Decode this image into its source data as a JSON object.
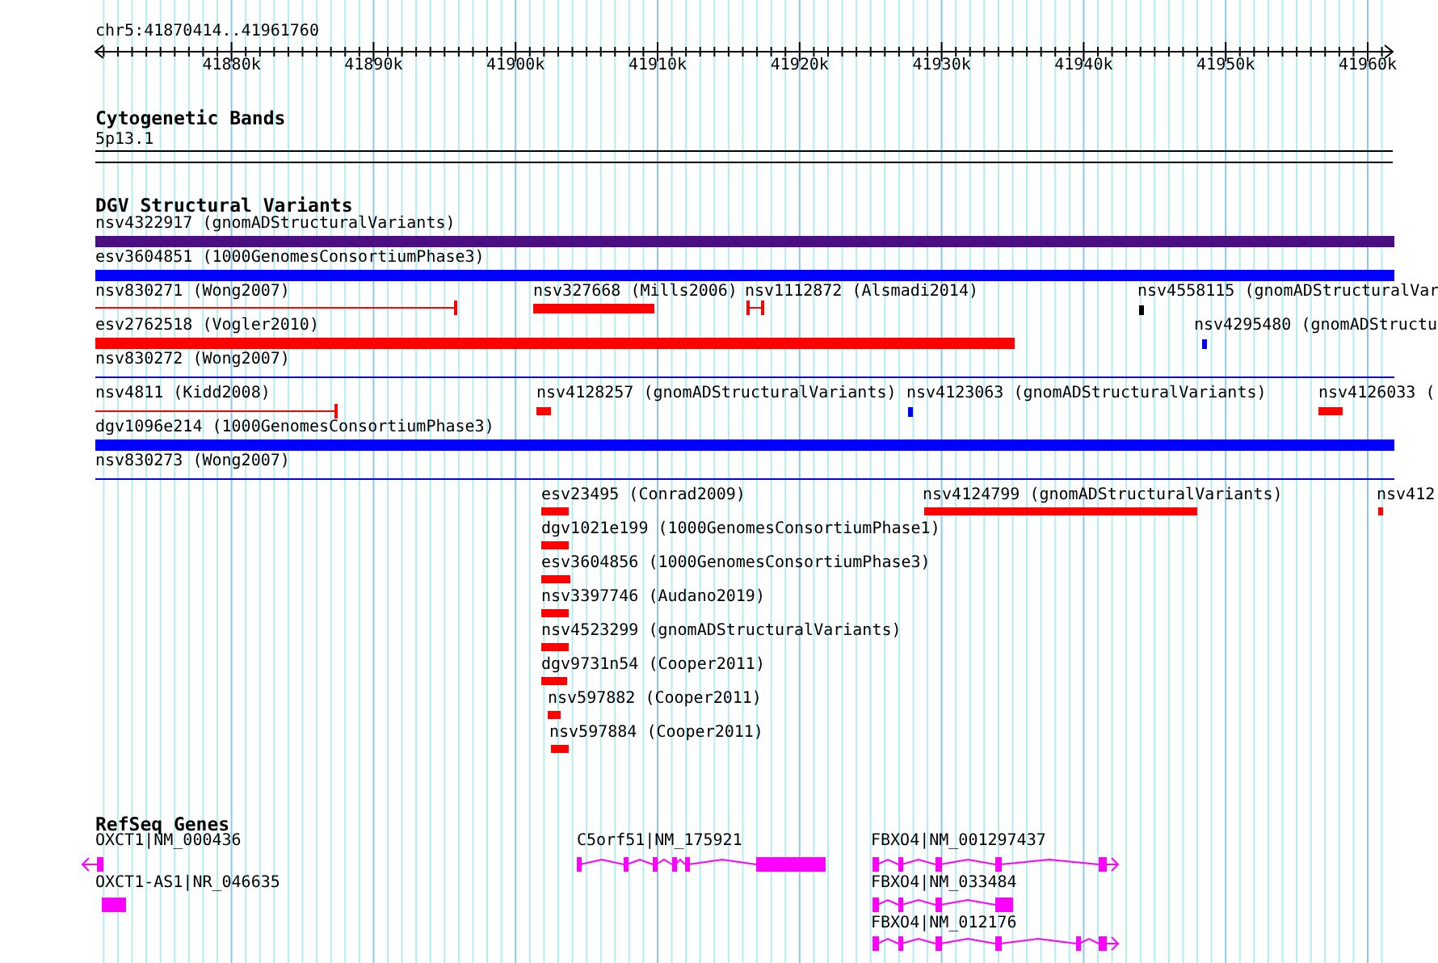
{
  "location": "chr5:41870414..41961760",
  "ruler": {
    "ticks": [
      "41880k",
      "41890k",
      "41900k",
      "41910k",
      "41920k",
      "41930k",
      "41940k",
      "41950k",
      "41960k"
    ]
  },
  "tracks": [
    {
      "kind": "bands",
      "title": "Cytogenetic Bands",
      "features": [
        {
          "label": "5p13.1"
        }
      ]
    },
    {
      "kind": "variants",
      "title": "DGV Structural Variants",
      "features": [
        {
          "label": "nsv4322917 (gnomADStructuralVariants)",
          "kind": "bar",
          "color": "#4b0f82"
        },
        {
          "label": "esv3604851 (1000GenomesConsortiumPhase3)",
          "kind": "bar",
          "color": "#0000ff"
        },
        {
          "label": "nsv830271 (Wong2007)",
          "kind": "line",
          "color": "#ff0000"
        },
        {
          "label": "nsv327668 (Mills2006)",
          "kind": "bar",
          "color": "#ff0000"
        },
        {
          "label": "nsv1112872 (Alsmadi2014)",
          "kind": "line",
          "color": "#ff0000"
        },
        {
          "label": "nsv4558115 (gnomADStructuralVar",
          "kind": "bar",
          "color": "#000000"
        },
        {
          "label": "esv2762518 (Vogler2010)",
          "kind": "bar",
          "color": "#ff0000"
        },
        {
          "label": "nsv4295480 (gnomADStructu",
          "kind": "bar",
          "color": "#0000ff"
        },
        {
          "label": "nsv830272 (Wong2007)",
          "kind": "line",
          "color": "#0000ff"
        },
        {
          "label": "nsv4811 (Kidd2008)",
          "kind": "line",
          "color": "#ff0000"
        },
        {
          "label": "nsv4128257 (gnomADStructuralVariants)",
          "kind": "bar",
          "color": "#ff0000"
        },
        {
          "label": "nsv4123063 (gnomADStructuralVariants)",
          "kind": "bar",
          "color": "#0000ff"
        },
        {
          "label": "nsv4126033 (",
          "kind": "bar",
          "color": "#ff0000"
        },
        {
          "label": "dgv1096e214 (1000GenomesConsortiumPhase3)",
          "kind": "bar",
          "color": "#0000ff"
        },
        {
          "label": "nsv830273 (Wong2007)",
          "kind": "line",
          "color": "#0000ff"
        },
        {
          "label": "esv23495 (Conrad2009)",
          "kind": "bar",
          "color": "#ff0000"
        },
        {
          "label": "nsv4124799 (gnomADStructuralVariants)",
          "kind": "bar",
          "color": "#ff0000"
        },
        {
          "label": "nsv412",
          "kind": "bar",
          "color": "#ff0000"
        },
        {
          "label": "dgv1021e199 (1000GenomesConsortiumPhase1)",
          "kind": "bar",
          "color": "#ff0000"
        },
        {
          "label": "esv3604856 (1000GenomesConsortiumPhase3)",
          "kind": "bar",
          "color": "#ff0000"
        },
        {
          "label": "nsv3397746 (Audano2019)",
          "kind": "bar",
          "color": "#ff0000"
        },
        {
          "label": "nsv4523299 (gnomADStructuralVariants)",
          "kind": "bar",
          "color": "#ff0000"
        },
        {
          "label": "dgv9731n54 (Cooper2011)",
          "kind": "bar",
          "color": "#ff0000"
        },
        {
          "label": "nsv597882 (Cooper2011)",
          "kind": "bar",
          "color": "#ff0000"
        },
        {
          "label": "nsv597884 (Cooper2011)",
          "kind": "bar",
          "color": "#ff0000"
        }
      ]
    },
    {
      "kind": "genes",
      "title": "RefSeq Genes",
      "features": [
        {
          "label": "OXCT1|NM_000436"
        },
        {
          "label": "OXCT1-AS1|NR_046635"
        },
        {
          "label": "C5orf51|NM_175921"
        },
        {
          "label": "FBXO4|NM_001297437"
        },
        {
          "label": "FBXO4|NM_033484"
        },
        {
          "label": "FBXO4|NM_012176"
        }
      ]
    }
  ]
}
